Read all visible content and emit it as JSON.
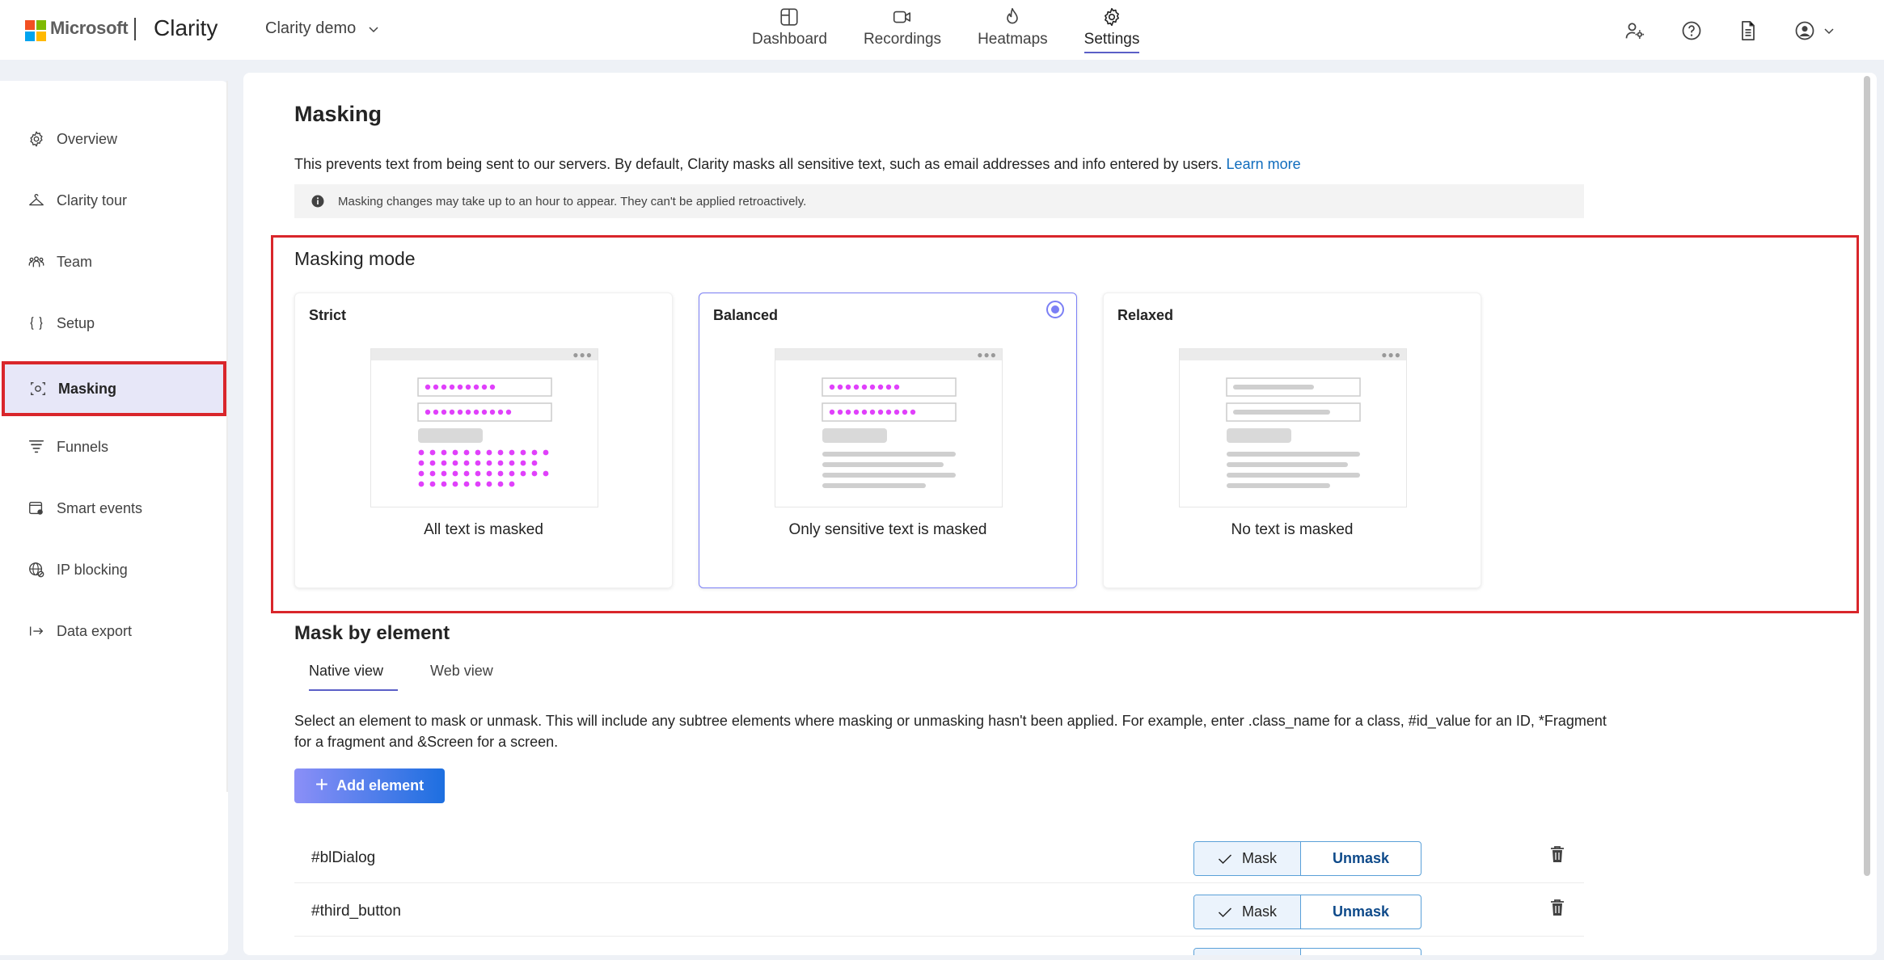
{
  "header": {
    "ms_text": "Microsoft",
    "brand": "Clarity",
    "project": "Clarity demo",
    "nav": [
      {
        "label": "Dashboard",
        "icon": "dashboard-icon"
      },
      {
        "label": "Recordings",
        "icon": "video-icon"
      },
      {
        "label": "Heatmaps",
        "icon": "flame-icon"
      },
      {
        "label": "Settings",
        "icon": "gear-icon",
        "active": true
      }
    ],
    "icons": [
      "people-settings-icon",
      "help-icon",
      "document-icon",
      "account-icon"
    ]
  },
  "sidebar": {
    "items": [
      {
        "label": "Overview",
        "icon": "gear-icon"
      },
      {
        "label": "Clarity tour",
        "icon": "hanger-icon"
      },
      {
        "label": "Team",
        "icon": "team-icon"
      },
      {
        "label": "Setup",
        "icon": "braces-icon"
      },
      {
        "label": "Masking",
        "icon": "masking-icon",
        "active": true
      },
      {
        "label": "Funnels",
        "icon": "funnel-icon"
      },
      {
        "label": "Smart events",
        "icon": "smart-events-icon"
      },
      {
        "label": "IP blocking",
        "icon": "globe-block-icon"
      },
      {
        "label": "Data export",
        "icon": "export-icon"
      }
    ]
  },
  "main": {
    "title": "Masking",
    "description": "This prevents text from being sent to our servers. By default, Clarity masks all sensitive text, such as email addresses and info entered by users.",
    "learn_more": "Learn more",
    "info": "Masking changes may take up to an hour to appear. They can't be applied retroactively.",
    "masking_mode": {
      "title": "Masking mode",
      "selected": "Balanced",
      "cards": [
        {
          "title": "Strict",
          "caption": "All text is masked"
        },
        {
          "title": "Balanced",
          "caption": "Only sensitive text is masked"
        },
        {
          "title": "Relaxed",
          "caption": "No text is masked"
        }
      ]
    },
    "mask_by_element": {
      "title": "Mask by element",
      "tabs": [
        {
          "label": "Native view",
          "active": true
        },
        {
          "label": "Web view"
        }
      ],
      "description": "Select an element to mask or unmask. This will include any subtree elements where masking or unmasking hasn't been applied. For example, enter .class_name for a class, #id_value for an ID, *Fragment for a fragment and &Screen for a screen.",
      "add_button": "Add element",
      "mask_label": "Mask",
      "unmask_label": "Unmask",
      "rows": [
        {
          "selector": "#blDialog",
          "state": "Mask"
        },
        {
          "selector": "#third_button",
          "state": "Mask"
        }
      ]
    }
  },
  "colors": {
    "accent": "#5b5fc7",
    "mask_dots": "#e040fb",
    "highlight_red": "#d9262b",
    "link": "#0f6cbd"
  }
}
